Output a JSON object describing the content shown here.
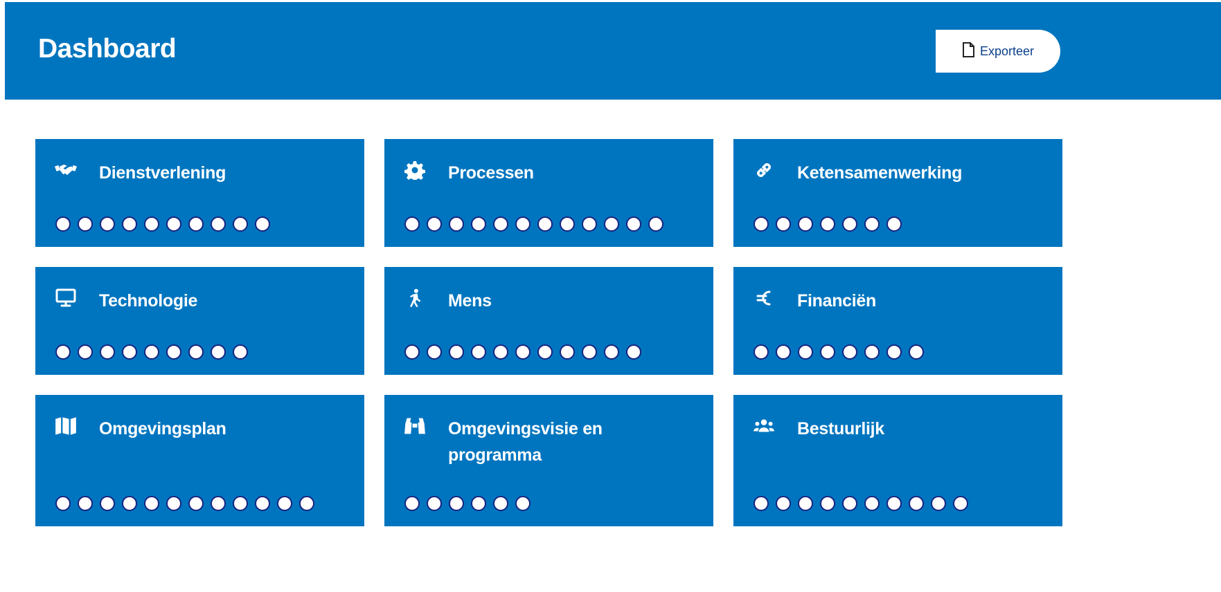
{
  "header": {
    "title": "Dashboard",
    "export_label": "Exporteer",
    "export_icon": "file-icon"
  },
  "colors": {
    "brand": "#0075bf",
    "dot_fill": "#ffffff",
    "dot_border": "#1a237e"
  },
  "cards": [
    {
      "label": "Dienstverlening",
      "icon": "handshake-icon",
      "dots": 10
    },
    {
      "label": "Processen",
      "icon": "gear-icon",
      "dots": 12
    },
    {
      "label": "Ketensamenwerking",
      "icon": "link-icon",
      "dots": 7
    },
    {
      "label": "Technologie",
      "icon": "monitor-icon",
      "dots": 9
    },
    {
      "label": "Mens",
      "icon": "walking-person-icon",
      "dots": 11
    },
    {
      "label": "Financiën",
      "icon": "euro-icon",
      "dots": 8
    },
    {
      "label": "Omgevingsplan",
      "icon": "map-icon",
      "dots": 12
    },
    {
      "label": "Omgevingsvisie en programma",
      "icon": "binoculars-icon",
      "dots": 6
    },
    {
      "label": "Bestuurlijk",
      "icon": "users-icon",
      "dots": 10
    }
  ]
}
